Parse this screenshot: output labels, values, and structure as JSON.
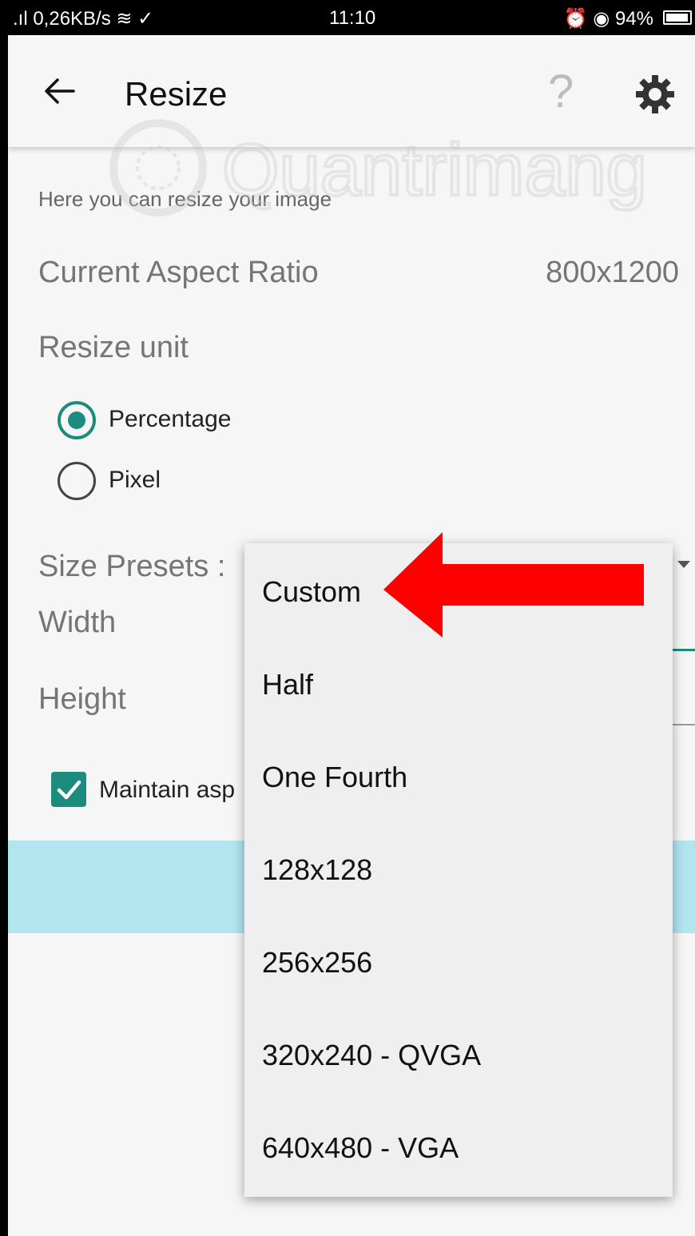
{
  "status_bar": {
    "left": ".ıl 0,26KB/s ≋ ✓",
    "time": "11:10",
    "right": "⏰ ◉ 94%"
  },
  "app_bar": {
    "title": "Resize"
  },
  "hint": "Here you can resize your image",
  "aspect_ratio": {
    "label": "Current Aspect Ratio",
    "value": "800x1200"
  },
  "resize_unit": {
    "label": "Resize unit",
    "options": [
      {
        "label": "Percentage",
        "selected": true
      },
      {
        "label": "Pixel",
        "selected": false
      }
    ]
  },
  "presets": {
    "label": "Size Presets :"
  },
  "width_label": "Width",
  "height_label": "Height",
  "maintain_aspect": {
    "label": "Maintain asp",
    "checked": true
  },
  "dropdown": {
    "items": [
      "Custom",
      "Half",
      "One Fourth",
      "128x128",
      "256x256",
      "320x240 - QVGA",
      "640x480 - VGA"
    ]
  },
  "watermark": "Quantrimang",
  "colors": {
    "accent": "#1b8c7e",
    "band": "#b3e5f1",
    "arrow": "#ff0000"
  }
}
